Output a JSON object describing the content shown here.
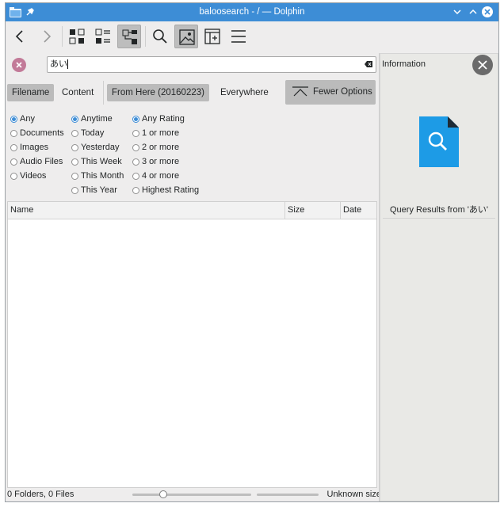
{
  "window": {
    "title": "baloosearch - / — Dolphin"
  },
  "titlebar": {
    "app_icon": "folder-icon",
    "pin_icon": "pin-icon",
    "controls": [
      "minimize",
      "maximize",
      "close"
    ]
  },
  "toolbar": {
    "buttons": [
      "back",
      "forward",
      "icons-view",
      "details-view",
      "compact-view",
      "search",
      "preview",
      "split",
      "menu"
    ],
    "active": [
      "compact-view",
      "preview"
    ]
  },
  "search": {
    "value": "あい"
  },
  "options": {
    "filename": "Filename",
    "content": "Content",
    "from_here": "From Here (20160223)",
    "everywhere": "Everywhere",
    "fewer_options": "Fewer Options",
    "selected": [
      "filename",
      "from_here"
    ]
  },
  "filters": {
    "type": {
      "items": [
        "Any",
        "Documents",
        "Images",
        "Audio Files",
        "Videos"
      ],
      "checked": "Any"
    },
    "date": {
      "items": [
        "Anytime",
        "Today",
        "Yesterday",
        "This Week",
        "This Month",
        "This Year"
      ],
      "checked": "Anytime"
    },
    "rating": {
      "items": [
        "Any Rating",
        "1 or more",
        "2 or more",
        "3 or more",
        "4 or more",
        "Highest Rating"
      ],
      "checked": "Any Rating"
    }
  },
  "list": {
    "headers": {
      "name": "Name",
      "size": "Size",
      "date": "Date"
    },
    "rows": []
  },
  "status": {
    "text": "0 Folders, 0 Files",
    "size": "Unknown size",
    "zoom": 0.27
  },
  "info_panel": {
    "title": "Information",
    "query": "Query Results from 'あい'",
    "icon": "search-file-icon"
  },
  "colors": {
    "titlebar": "#3d8dd6",
    "accent": "#3d8dd6",
    "clear_button": "#c27a98"
  }
}
